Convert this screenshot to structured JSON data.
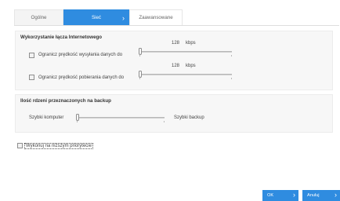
{
  "tabs": [
    {
      "label": "Ogólne"
    },
    {
      "label": "Sieć",
      "active": true
    },
    {
      "label": "Zaawansowane"
    }
  ],
  "bandwidth": {
    "title": "Wykorzystanie łącza Internetowego",
    "upload": {
      "label": "Ogranicz prędkość wysyłania danych do",
      "value": "128",
      "unit": "kbps",
      "checked": false,
      "slider_fraction": 0.0
    },
    "download": {
      "label": "Ogranicz prędkość pobierania danych do",
      "value": "128",
      "unit": "kbps",
      "checked": false,
      "slider_fraction": 0.0
    }
  },
  "cores": {
    "title": "Ilość rdzeni przeznaczonych na backup",
    "left_label": "Szybki komputer",
    "right_label": "Szybki backup",
    "slider_fraction": 0.0
  },
  "priority": {
    "label": "Wykonuj na niższym priorytecie",
    "checked": false
  },
  "buttons": {
    "ok": "OK",
    "cancel": "Anuluj"
  },
  "colors": {
    "accent": "#2f8ce0",
    "panel_bg": "#f7f7f7"
  },
  "icons": {
    "chevron": "chevron-right-icon"
  }
}
